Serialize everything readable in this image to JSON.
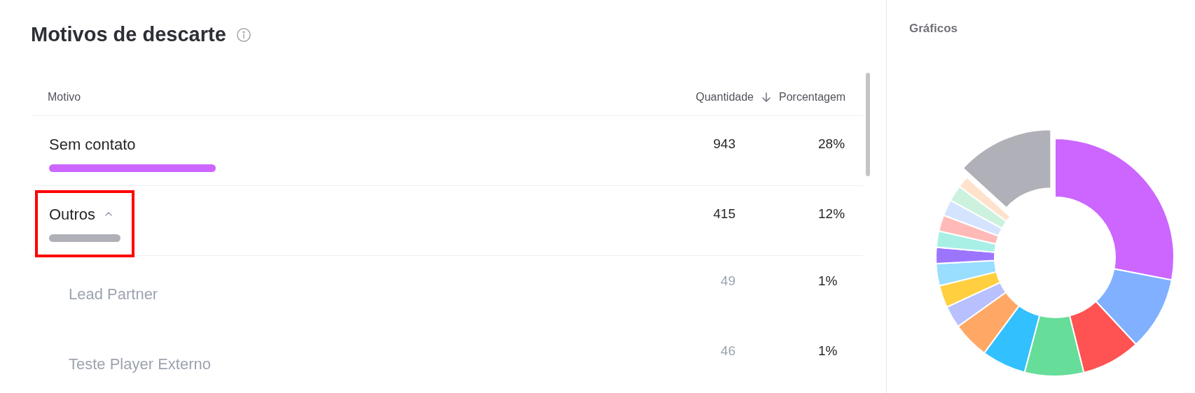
{
  "title": "Motivos de descarte",
  "table": {
    "columns": [
      {
        "label": "Motivo"
      },
      {
        "label": "Quantidade",
        "sorted": true
      },
      {
        "label": "Porcentagem"
      }
    ],
    "rows": [
      {
        "label": "Sem contato",
        "quantity": "943",
        "percentage": "28%",
        "color": "#cc66ff"
      },
      {
        "label": "Outros",
        "quantity": "415",
        "percentage": "12%",
        "color": "#b0b0b8",
        "expanded": true,
        "highlighted": true,
        "children": [
          {
            "label": "Lead Partner",
            "quantity": "49",
            "percentage": "1%"
          },
          {
            "label": "Teste Player Externo",
            "quantity": "46",
            "percentage": "1%"
          }
        ]
      }
    ]
  },
  "chart_panel": {
    "title": "Gráficos"
  }
}
